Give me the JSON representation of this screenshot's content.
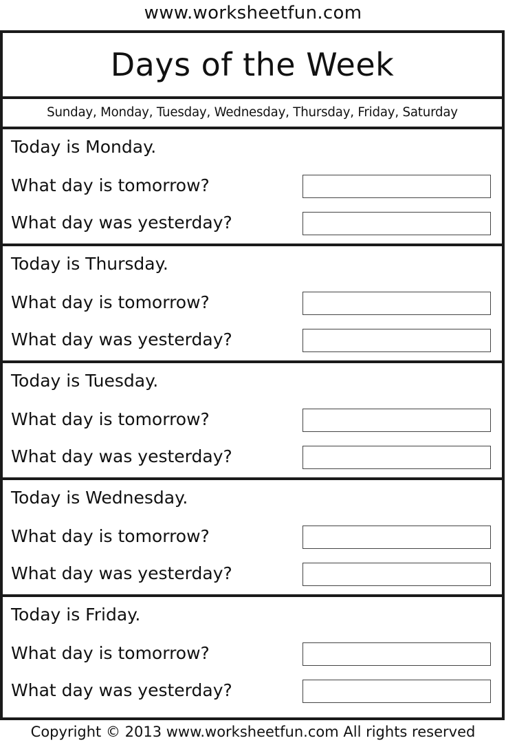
{
  "header": {
    "site": "www.worksheetfun.com"
  },
  "worksheet": {
    "title": "Days of the Week",
    "day_list": "Sunday, Monday, Tuesday, Wednesday, Thursday, Friday, Saturday",
    "sections": [
      {
        "today": "Today is Monday.",
        "q_tomorrow": "What day is tomorrow?",
        "q_yesterday": "What day was yesterday?",
        "answer_tomorrow": "",
        "answer_yesterday": ""
      },
      {
        "today": "Today is Thursday.",
        "q_tomorrow": "What day is tomorrow?",
        "q_yesterday": "What day was yesterday?",
        "answer_tomorrow": "",
        "answer_yesterday": ""
      },
      {
        "today": "Today is Tuesday.",
        "q_tomorrow": "What day is tomorrow?",
        "q_yesterday": "What day was yesterday?",
        "answer_tomorrow": "",
        "answer_yesterday": ""
      },
      {
        "today": "Today is Wednesday.",
        "q_tomorrow": "What day is tomorrow?",
        "q_yesterday": "What day was yesterday?",
        "answer_tomorrow": "",
        "answer_yesterday": ""
      },
      {
        "today": "Today is Friday.",
        "q_tomorrow": "What day is tomorrow?",
        "q_yesterday": "What day was yesterday?",
        "answer_tomorrow": "",
        "answer_yesterday": ""
      }
    ]
  },
  "footer": {
    "copyright": "Copyright © 2013 www.worksheetfun.com All rights reserved"
  }
}
